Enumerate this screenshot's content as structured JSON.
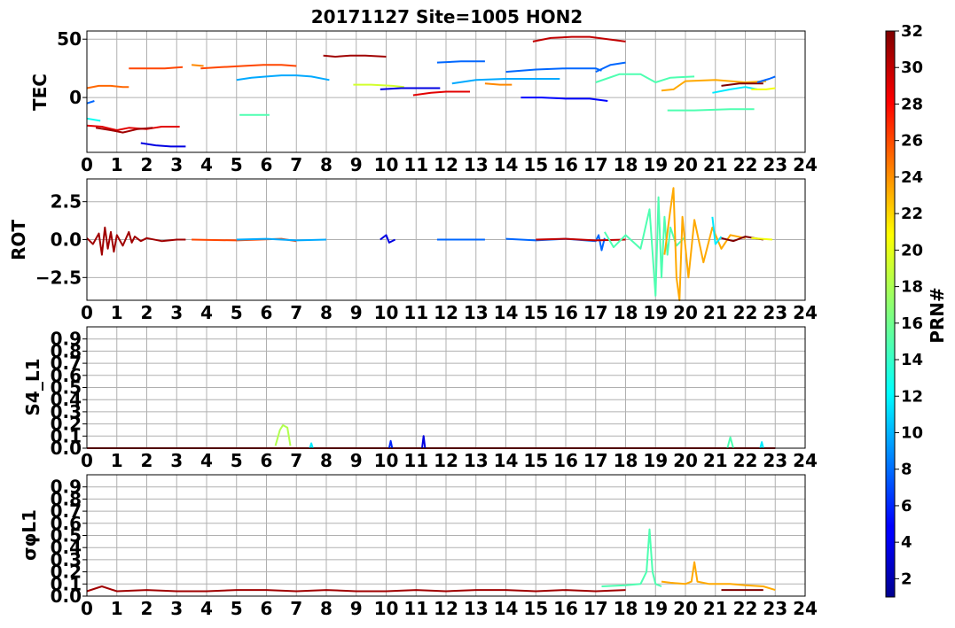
{
  "title": "20171127 Site=1005 HON2",
  "colorbar": {
    "label": "PRN#",
    "ticks": [
      "2",
      "4",
      "6",
      "8",
      "10",
      "12",
      "14",
      "16",
      "18",
      "20",
      "22",
      "24",
      "26",
      "28",
      "30",
      "32"
    ],
    "top_tick": "32",
    "range": [
      1,
      32
    ],
    "colormap": "jet"
  },
  "x_ticks": [
    "0",
    "1",
    "2",
    "3",
    "4",
    "5",
    "6",
    "7",
    "8",
    "9",
    "10",
    "11",
    "12",
    "13",
    "14",
    "15",
    "16",
    "17",
    "18",
    "19",
    "20",
    "21",
    "22",
    "23",
    "24"
  ],
  "chart_data": [
    {
      "type": "line",
      "panel": "TEC",
      "ylabel": "TEC",
      "xlim": [
        0,
        24
      ],
      "ylim": [
        -47,
        57
      ],
      "y_ticks": [
        "50",
        "0"
      ],
      "y_tick_values": [
        50,
        0
      ],
      "grid": true,
      "series": [
        {
          "prn": 29,
          "x": [
            0,
            0.5,
            1.0,
            1.4,
            2.0,
            2.5,
            3.1
          ],
          "y": [
            -24,
            -25,
            -28,
            -26,
            -27,
            -25,
            -25
          ]
        },
        {
          "prn": 31,
          "x": [
            0.3,
            0.8,
            1.2,
            1.7,
            2.2
          ],
          "y": [
            -26,
            -28,
            -30,
            -27,
            -26
          ]
        },
        {
          "prn": 13,
          "x": [
            0,
            0.45
          ],
          "y": [
            -18,
            -20
          ]
        },
        {
          "prn": 8,
          "x": [
            0,
            0.25
          ],
          "y": [
            -5,
            -3
          ]
        },
        {
          "prn": 25,
          "x": [
            0,
            0.4,
            0.8,
            1.2,
            1.4
          ],
          "y": [
            8,
            10,
            10,
            9,
            9
          ]
        },
        {
          "prn": 4,
          "x": [
            1.8,
            2.3,
            2.8,
            3.3
          ],
          "y": [
            -39,
            -41,
            -42,
            -42
          ]
        },
        {
          "prn": 26,
          "x": [
            1.4,
            2.0,
            2.6,
            3.2
          ],
          "y": [
            25,
            25,
            25,
            26
          ]
        },
        {
          "prn": 24,
          "x": [
            3.5,
            3.9
          ],
          "y": [
            28,
            27
          ]
        },
        {
          "prn": 26,
          "x": [
            3.8,
            4.5,
            5.2,
            5.9,
            6.5,
            7.0
          ],
          "y": [
            25,
            26,
            27,
            28,
            28,
            27
          ]
        },
        {
          "prn": 10,
          "x": [
            5.0,
            5.5,
            6.0,
            6.5,
            7.0,
            7.5,
            8.1
          ],
          "y": [
            15,
            17,
            18,
            19,
            19,
            18,
            15
          ]
        },
        {
          "prn": 15,
          "x": [
            5.1,
            6.1
          ],
          "y": [
            -15,
            -15
          ]
        },
        {
          "prn": 31,
          "x": [
            7.9,
            8.3,
            8.8,
            9.3,
            10.0
          ],
          "y": [
            36,
            35,
            36,
            36,
            35
          ]
        },
        {
          "prn": 19,
          "x": [
            8.9,
            9.5,
            10.2,
            10.6
          ],
          "y": [
            11,
            11,
            10,
            9
          ]
        },
        {
          "prn": 4,
          "x": [
            9.8,
            10.5,
            11.1,
            11.8
          ],
          "y": [
            7,
            8,
            8,
            8
          ]
        },
        {
          "prn": 29,
          "x": [
            10.9,
            11.5,
            12.0,
            12.8
          ],
          "y": [
            2,
            4,
            5,
            5
          ]
        },
        {
          "prn": 8,
          "x": [
            11.7,
            12.5,
            13.3
          ],
          "y": [
            30,
            31,
            31
          ]
        },
        {
          "prn": 10,
          "x": [
            12.2,
            13.0,
            14.0,
            15.0,
            15.8
          ],
          "y": [
            12,
            15,
            16,
            16,
            16
          ]
        },
        {
          "prn": 24,
          "x": [
            13.3,
            13.8,
            14.2
          ],
          "y": [
            12,
            11,
            11
          ]
        },
        {
          "prn": 5,
          "x": [
            14.5,
            15.2,
            16.0,
            16.8,
            17.4
          ],
          "y": [
            0,
            0,
            -1,
            -1,
            -3
          ]
        },
        {
          "prn": 8,
          "x": [
            14.0,
            15.0,
            16.0,
            17.0,
            17.2
          ],
          "y": [
            22,
            24,
            25,
            25,
            23
          ]
        },
        {
          "prn": 8,
          "x": [
            17.0,
            17.5,
            18.0
          ],
          "y": [
            22,
            28,
            30
          ]
        },
        {
          "prn": 30,
          "x": [
            14.9,
            15.5,
            16.2,
            16.8,
            17.4,
            18.0
          ],
          "y": [
            48,
            51,
            52,
            52,
            50,
            48
          ]
        },
        {
          "prn": 15,
          "x": [
            17.0,
            17.8,
            18.5,
            19.0,
            19.5,
            20.3
          ],
          "y": [
            13,
            20,
            20,
            13,
            17,
            18
          ]
        },
        {
          "prn": 23,
          "x": [
            19.2,
            19.6,
            20.0,
            21.0,
            22.0,
            22.7
          ],
          "y": [
            6,
            7,
            14,
            15,
            13,
            14
          ]
        },
        {
          "prn": 15,
          "x": [
            19.4,
            20.3,
            21.5,
            22.3
          ],
          "y": [
            -11,
            -11,
            -10,
            -10
          ]
        },
        {
          "prn": 12,
          "x": [
            20.9,
            21.5,
            22.0,
            22.4
          ],
          "y": [
            4,
            7,
            9,
            7
          ]
        },
        {
          "prn": 32,
          "x": [
            21.2,
            21.8,
            22.6
          ],
          "y": [
            10,
            12,
            12
          ]
        },
        {
          "prn": 8,
          "x": [
            22.4,
            22.8,
            23.0
          ],
          "y": [
            13,
            16,
            18
          ]
        },
        {
          "prn": 20,
          "x": [
            22.2,
            22.7,
            23.0
          ],
          "y": [
            7,
            7,
            8
          ]
        }
      ]
    },
    {
      "type": "line",
      "panel": "ROT",
      "ylabel": "ROT",
      "xlim": [
        0,
        24
      ],
      "ylim": [
        -4,
        4
      ],
      "y_ticks": [
        "2.5",
        "0.0",
        "−2.5"
      ],
      "y_tick_values": [
        2.5,
        0,
        -2.5
      ],
      "grid": true,
      "series": [
        {
          "prn": 31,
          "x": [
            0,
            0.2,
            0.4,
            0.5,
            0.6,
            0.7,
            0.8,
            0.9,
            1.0,
            1.2,
            1.4,
            1.5,
            1.6,
            1.8,
            2.0,
            2.5,
            3.0,
            3.3
          ],
          "y": [
            0.1,
            -0.3,
            0.4,
            -1.0,
            0.8,
            -0.6,
            0.5,
            -0.8,
            0.3,
            -0.4,
            0.5,
            -0.2,
            0.2,
            -0.1,
            0.1,
            -0.1,
            0.0,
            0.0
          ]
        },
        {
          "prn": 26,
          "x": [
            3.5,
            5,
            6.5,
            7
          ],
          "y": [
            0.0,
            -0.05,
            0.05,
            -0.1
          ]
        },
        {
          "prn": 10,
          "x": [
            5,
            6,
            7,
            8
          ],
          "y": [
            0.0,
            0.05,
            -0.05,
            0.0
          ]
        },
        {
          "prn": 4,
          "x": [
            9.8,
            10.0,
            10.1,
            10.3
          ],
          "y": [
            0.0,
            0.3,
            -0.2,
            0.0
          ]
        },
        {
          "prn": 8,
          "x": [
            11.7,
            13.3
          ],
          "y": [
            0.0,
            0.0
          ]
        },
        {
          "prn": 8,
          "x": [
            14,
            15,
            16,
            17,
            17.1,
            17.2,
            17.3
          ],
          "y": [
            0.05,
            -0.05,
            0.05,
            -0.1,
            0.3,
            -0.7,
            0.1
          ]
        },
        {
          "prn": 30,
          "x": [
            15,
            16,
            17,
            18
          ],
          "y": [
            0.0,
            0.05,
            -0.05,
            0.0
          ]
        },
        {
          "prn": 15,
          "x": [
            17.3,
            17.6,
            18.0,
            18.5,
            18.8,
            19.0,
            19.1,
            19.2,
            19.3,
            19.4,
            19.5,
            19.7,
            20.0
          ],
          "y": [
            0.5,
            -0.5,
            0.3,
            -0.6,
            2.0,
            -3.7,
            2.8,
            -2.5,
            1.5,
            -1.0,
            0.8,
            -0.4,
            0.2
          ]
        },
        {
          "prn": 23,
          "x": [
            19.3,
            19.5,
            19.6,
            19.7,
            19.8,
            19.9,
            20.1,
            20.3,
            20.6,
            20.9,
            21.2,
            21.5,
            22.0
          ],
          "y": [
            -1.0,
            2.0,
            3.4,
            -2.5,
            -4.0,
            1.5,
            -2.5,
            1.3,
            -1.5,
            0.8,
            -0.6,
            0.3,
            0.1
          ]
        },
        {
          "prn": 12,
          "x": [
            20.9,
            21.0,
            21.2
          ],
          "y": [
            1.5,
            -0.3,
            0.2
          ]
        },
        {
          "prn": 32,
          "x": [
            21.2,
            21.6,
            22.0,
            22.6
          ],
          "y": [
            0.1,
            -0.1,
            0.2,
            0.0
          ]
        },
        {
          "prn": 20,
          "x": [
            22.2,
            22.9
          ],
          "y": [
            0.1,
            0.0
          ]
        }
      ]
    },
    {
      "type": "line",
      "panel": "S4_L1",
      "ylabel": "S4_L1",
      "xlim": [
        0,
        24
      ],
      "ylim": [
        0,
        1
      ],
      "y_ticks": [
        "0.0",
        "0.1",
        "0.2",
        "0.3",
        "0.4",
        "0.5",
        "0.6",
        "0.7",
        "0.8",
        "0.9"
      ],
      "y_tick_values": [
        0,
        0.1,
        0.2,
        0.3,
        0.4,
        0.5,
        0.6,
        0.7,
        0.8,
        0.9
      ],
      "grid": true,
      "series": [
        {
          "prn": 31,
          "x": [
            0,
            23
          ],
          "y": [
            0.0,
            0.0
          ]
        },
        {
          "prn": 18,
          "x": [
            6.3,
            6.45,
            6.55,
            6.7,
            6.8
          ],
          "y": [
            0.02,
            0.15,
            0.19,
            0.17,
            0.02
          ]
        },
        {
          "prn": 12,
          "x": [
            7.45,
            7.5,
            7.55
          ],
          "y": [
            0.0,
            0.04,
            0.0
          ]
        },
        {
          "prn": 6,
          "x": [
            10.1,
            10.15,
            10.2
          ],
          "y": [
            0.0,
            0.06,
            0.0
          ]
        },
        {
          "prn": 4,
          "x": [
            11.2,
            11.25,
            11.3
          ],
          "y": [
            0.0,
            0.1,
            0.0
          ]
        },
        {
          "prn": 15,
          "x": [
            21.4,
            21.5,
            21.6
          ],
          "y": [
            0.0,
            0.09,
            0.0
          ]
        },
        {
          "prn": 12,
          "x": [
            22.5,
            22.55,
            22.6
          ],
          "y": [
            0.0,
            0.05,
            0.0
          ]
        }
      ]
    },
    {
      "type": "line",
      "panel": "sigma_phi_L1",
      "ylabel": "σφL1",
      "xlim": [
        0,
        24
      ],
      "ylim": [
        0,
        1
      ],
      "y_ticks": [
        "0.0",
        "0.1",
        "0.2",
        "0.3",
        "0.4",
        "0.5",
        "0.6",
        "0.7",
        "0.8",
        "0.9"
      ],
      "y_tick_values": [
        0,
        0.1,
        0.2,
        0.3,
        0.4,
        0.5,
        0.6,
        0.7,
        0.8,
        0.9
      ],
      "grid": true,
      "series": [
        {
          "prn": 31,
          "x": [
            0,
            0.5,
            1.0,
            2,
            3,
            4,
            5,
            6,
            7,
            8,
            9,
            10,
            11,
            12,
            13,
            14,
            15,
            16,
            17,
            18
          ],
          "y": [
            0.04,
            0.08,
            0.04,
            0.05,
            0.04,
            0.04,
            0.05,
            0.05,
            0.04,
            0.05,
            0.04,
            0.04,
            0.05,
            0.04,
            0.05,
            0.05,
            0.04,
            0.05,
            0.04,
            0.05
          ]
        },
        {
          "prn": 15,
          "x": [
            17.2,
            18.0,
            18.5,
            18.7,
            18.8,
            18.9,
            19.0,
            19.2
          ],
          "y": [
            0.08,
            0.09,
            0.1,
            0.2,
            0.55,
            0.2,
            0.1,
            0.08
          ]
        },
        {
          "prn": 23,
          "x": [
            19.2,
            19.5,
            20.0,
            20.2,
            20.3,
            20.4,
            20.8,
            21.5,
            22.0,
            22.6,
            23.0
          ],
          "y": [
            0.12,
            0.11,
            0.1,
            0.12,
            0.28,
            0.12,
            0.1,
            0.1,
            0.09,
            0.08,
            0.05
          ]
        },
        {
          "prn": 32,
          "x": [
            21.2,
            22.6
          ],
          "y": [
            0.05,
            0.05
          ]
        }
      ]
    }
  ]
}
